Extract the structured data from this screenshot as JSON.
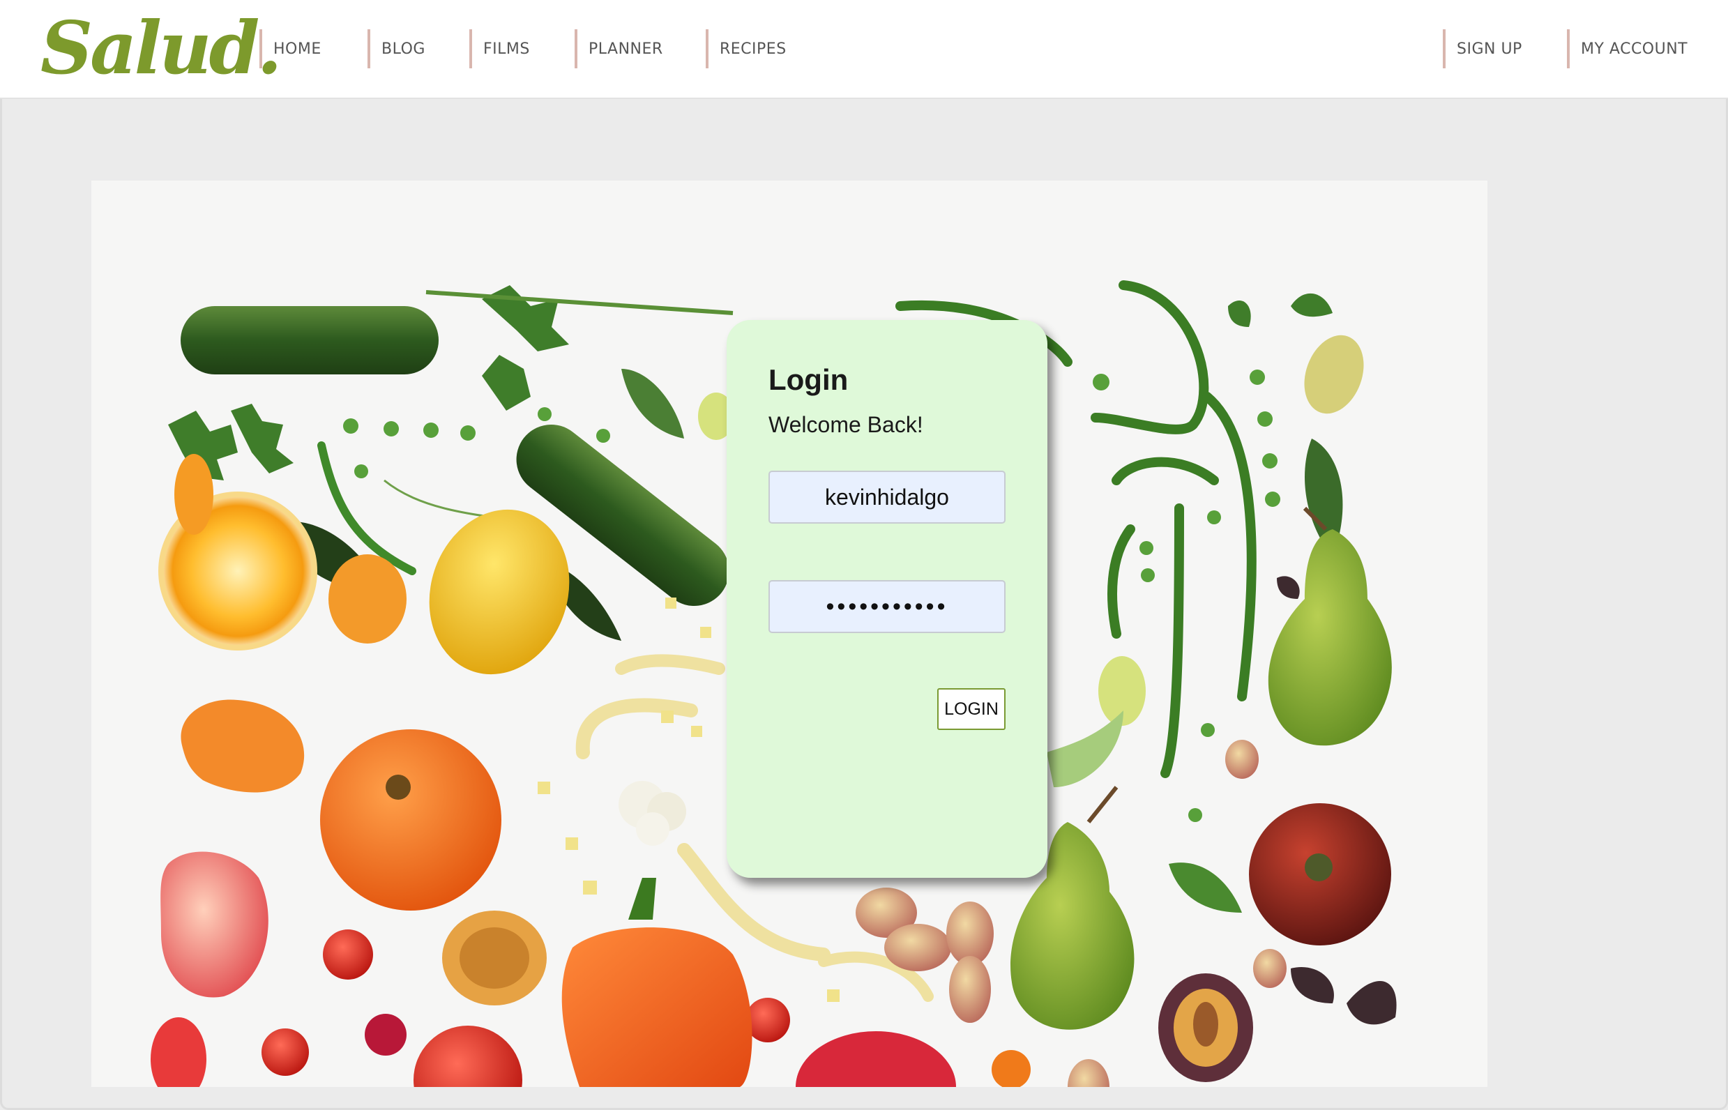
{
  "header": {
    "logo": "Salud.",
    "nav_left": [
      {
        "label": "HOME"
      },
      {
        "label": "BLOG"
      },
      {
        "label": "FILMS"
      },
      {
        "label": "PLANNER"
      },
      {
        "label": "RECIPES"
      }
    ],
    "nav_right": [
      {
        "label": "SIGN UP"
      },
      {
        "label": "MY ACCOUNT"
      }
    ]
  },
  "hero": {
    "image": "fresh-vegetables-and-fruits-photo"
  },
  "login": {
    "title": "Login",
    "subtitle": "Welcome Back!",
    "username_value": "kevinhidalgo",
    "password_value": "•••••••••••",
    "button_label": "LOGIN"
  },
  "colors": {
    "brand_green": "#7d9a2c",
    "nav_divider": "#d9b6ae",
    "card_background": "#dff9d9",
    "field_background": "#e8f0fe",
    "page_background": "#ebebeb"
  }
}
